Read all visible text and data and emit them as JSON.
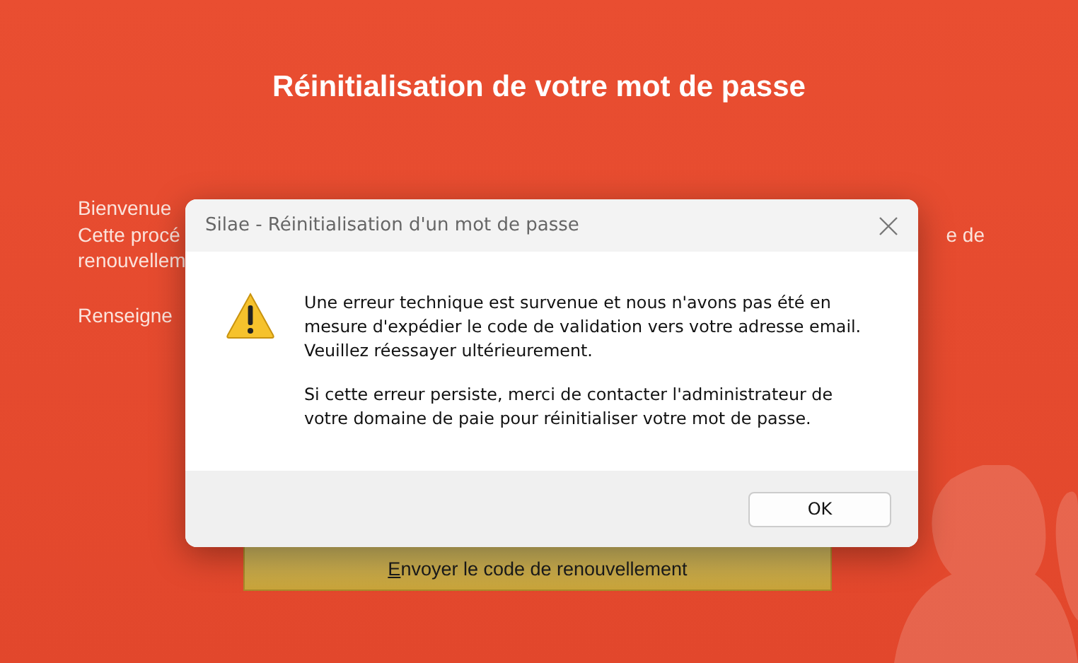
{
  "page": {
    "title": "Réinitialisation de votre mot de passe",
    "left_lines": [
      "Bienvenue",
      "Cette procé",
      "renouvellem"
    ],
    "left_prompt": "Renseigne",
    "right_fragment": "e de",
    "send_button": {
      "label": "Envoyer le code de renouvellement"
    }
  },
  "dialog": {
    "title": "Silae - Réinitialisation d'un mot de passe",
    "paragraphs": [
      "Une erreur technique est survenue et nous n'avons pas été en mesure d'expédier le code de validation vers votre adresse email. Veuillez réessayer ultérieurement.",
      "Si cette erreur persiste, merci de contacter l'administrateur de votre domaine de paie pour réinitialiser votre mot de passe."
    ],
    "buttons": [
      "OK"
    ]
  }
}
